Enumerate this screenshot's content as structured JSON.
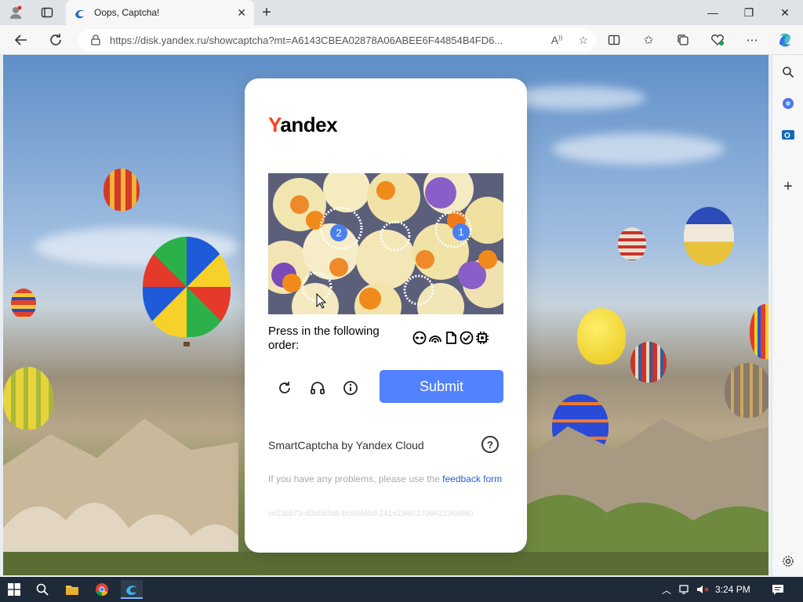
{
  "browser": {
    "tab_title": "Oops, Captcha!",
    "tab_close": "✕",
    "new_tab": "+",
    "url": "https://disk.yandex.ru/showcaptcha?mt=A6143CBEA02878A06ABEE6F44854B4FD6...",
    "window": {
      "minimize": "—",
      "restore": "❐",
      "close": "✕"
    }
  },
  "captcha": {
    "logo_first": "Y",
    "logo_rest": "andex",
    "instruction": "Press in the following order:",
    "submit_label": "Submit",
    "brand": "SmartCaptcha by Yandex Cloud",
    "help": "?",
    "problems_text": "If you have any problems, please use the ",
    "feedback_link": "feedback form",
    "token": "ce23cb73-d3a6b3ab-bc99465d-241e2340:1709421364860",
    "marker_1": "1",
    "marker_2": "2"
  },
  "taskbar": {
    "time": "3:24 PM"
  },
  "colors": {
    "submit": "#5282ff",
    "yandex_red": "#fc3f1d",
    "link": "#2b5bd6"
  }
}
